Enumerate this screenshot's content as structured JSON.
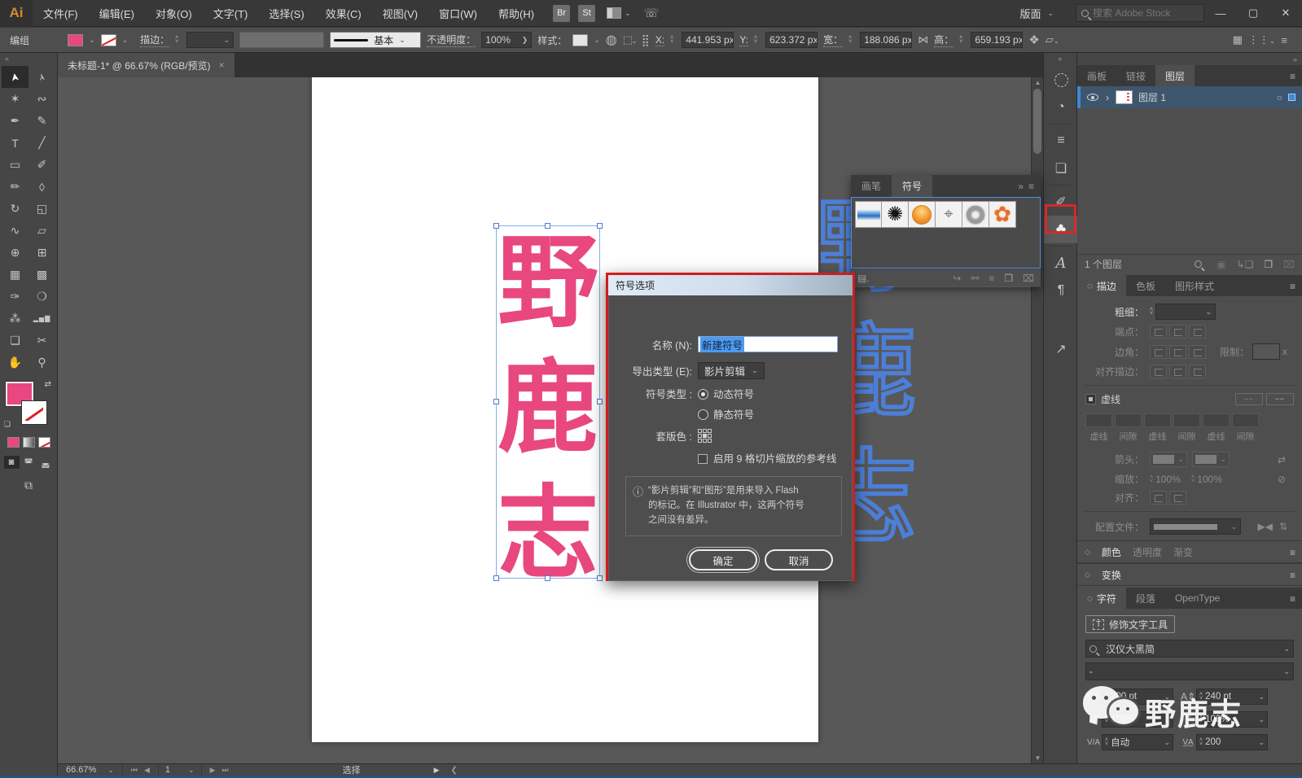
{
  "menubar": {
    "logo": "Ai",
    "items": [
      "文件(F)",
      "编辑(E)",
      "对象(O)",
      "文字(T)",
      "选择(S)",
      "效果(C)",
      "视图(V)",
      "窗口(W)",
      "帮助(H)"
    ],
    "bridge_badge": "Br",
    "stock_badge": "St",
    "workspace_label": "版面",
    "search_placeholder": "搜索 Adobe Stock",
    "window_controls": {
      "minimize": "—",
      "maximize": "▢",
      "close": "✕"
    }
  },
  "controlbar": {
    "selection_type": "编组",
    "stroke_label": "描边：",
    "brush_style": "基本",
    "opacity_label": "不透明度：",
    "opacity_value": "100%",
    "opacity_more": "❯",
    "style_label": "样式：",
    "x_label": "X:",
    "x_value": "441.953 px",
    "y_label": "Y:",
    "y_value": "623.372 px",
    "w_label": "宽：",
    "w_value": "188.086 px",
    "h_label": "高：",
    "h_value": "659.193 px"
  },
  "document_tab": {
    "title": "未标题-1* @ 66.67% (RGB/预览)",
    "close": "×"
  },
  "toolbar": {
    "collapse": "«",
    "tools": [
      {
        "name": "selection-tool",
        "glyph": "➤"
      },
      {
        "name": "direct-selection-tool",
        "glyph": "➢"
      },
      {
        "name": "magic-wand-tool",
        "glyph": "✶"
      },
      {
        "name": "lasso-tool",
        "glyph": "∾"
      },
      {
        "name": "pen-tool",
        "glyph": "✒"
      },
      {
        "name": "curvature-tool",
        "glyph": "✎"
      },
      {
        "name": "type-tool",
        "glyph": "T"
      },
      {
        "name": "line-tool",
        "glyph": "╱"
      },
      {
        "name": "rectangle-tool",
        "glyph": "▭"
      },
      {
        "name": "paintbrush-tool",
        "glyph": "✐"
      },
      {
        "name": "shaper-tool",
        "glyph": "✏"
      },
      {
        "name": "eraser-tool",
        "glyph": "◊"
      },
      {
        "name": "rotate-tool",
        "glyph": "↻"
      },
      {
        "name": "scale-tool",
        "glyph": "◱"
      },
      {
        "name": "width-tool",
        "glyph": "∿"
      },
      {
        "name": "free-transform-tool",
        "glyph": "▱"
      },
      {
        "name": "shape-builder-tool",
        "glyph": "⊕"
      },
      {
        "name": "perspective-grid-tool",
        "glyph": "⊞"
      },
      {
        "name": "mesh-tool",
        "glyph": "▦"
      },
      {
        "name": "gradient-tool",
        "glyph": "▩"
      },
      {
        "name": "eyedropper-tool",
        "glyph": "✑"
      },
      {
        "name": "blend-tool",
        "glyph": "❍"
      },
      {
        "name": "symbol-sprayer-tool",
        "glyph": "⁂"
      },
      {
        "name": "graph-tool",
        "glyph": "▂▅▇"
      },
      {
        "name": "artboard-tool",
        "glyph": "❏"
      },
      {
        "name": "slice-tool",
        "glyph": "✂"
      },
      {
        "name": "hand-tool",
        "glyph": "✋"
      },
      {
        "name": "zoom-tool",
        "glyph": "⚲"
      }
    ]
  },
  "canvas": {
    "chars": [
      "野",
      "鹿",
      "志"
    ]
  },
  "symbols_panel": {
    "tabs": [
      "画笔",
      "符号"
    ],
    "expand": "»",
    "menu": "≡",
    "items": [
      "blue-ribbon",
      "ink-splatter",
      "orange-orb",
      "registration-marks",
      "twirl-ring",
      "flower"
    ],
    "footer_icons": [
      "symbol-library",
      "place-instance",
      "break-link",
      "symbol-options",
      "new-symbol",
      "delete"
    ]
  },
  "dialog": {
    "title": "符号选项",
    "name_label": "名称 (N):",
    "name_value": "新建符号",
    "export_label": "导出类型 (E):",
    "export_value": "影片剪辑",
    "type_label": "符号类型 :",
    "radio_dynamic": "动态符号",
    "radio_static": "静态符号",
    "registration_label": "套版色 :",
    "guides_checkbox": "启用 9 格切片缩放的参考线",
    "info_icon": "ⓘ",
    "info_text": "“影片剪辑”和“图形”是用来导入 Flash\n的标记。在 Illustrator 中，这两个符号\n之间没有差异。",
    "ok": "确定",
    "cancel": "取消"
  },
  "dock": {
    "collapse": "«"
  },
  "panels": {
    "expand": "»",
    "layers": {
      "tabs": [
        "画板",
        "链接",
        "图层"
      ],
      "layer_name": "图层 1",
      "footer_count": "1 个图层"
    },
    "stroke": {
      "tabs": [
        "描边",
        "色板",
        "图形样式"
      ],
      "weight_label": "粗细：",
      "cap_label": "端点：",
      "corner_label": "边角：",
      "limit_label": "限制：",
      "limit_suffix": "x",
      "align_label": "对齐描边：",
      "dash_label": "虚线",
      "dash_cols": [
        "虚线",
        "间隙",
        "虚线",
        "间隙",
        "虚线",
        "间隙"
      ],
      "arrow_label": "箭头：",
      "scale_label": "缩放：",
      "scale1": "100%",
      "scale2": "100%",
      "align2_label": "对齐：",
      "profile_label": "配置文件："
    },
    "color_header": {
      "tabs": [
        "颜色",
        "透明度",
        "渐变"
      ]
    },
    "transform_header": {
      "label": "变换"
    },
    "character": {
      "tabs": [
        "字符",
        "段落",
        "OpenType"
      ],
      "touch_type_button": "修饰文字工具",
      "font_name": "汉仪大黑简",
      "style_value": "-",
      "size_value": "200 pt",
      "leading_value": "240 pt",
      "vscale_value": "100%",
      "hscale_value": "100%",
      "kerning_value": "自动",
      "tracking_value": "200"
    }
  },
  "statusbar": {
    "zoom": "66.67%",
    "artboard": "1",
    "mode": "选择"
  },
  "watermark": {
    "text": "野鹿志"
  },
  "colors": {
    "accent_pink": "#e8487f",
    "selection_blue": "#3f87d9",
    "annotation_red": "#d42a2a"
  }
}
